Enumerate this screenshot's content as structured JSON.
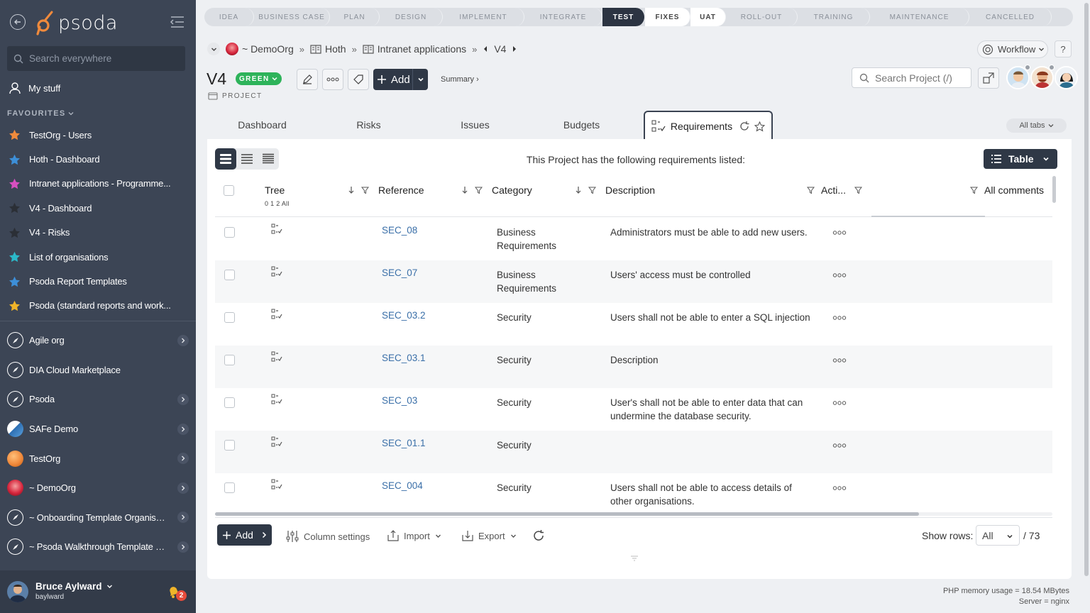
{
  "app": {
    "logo_text": "psoda"
  },
  "sidebar": {
    "search_placeholder": "Search everywhere",
    "my_stuff": "My stuff",
    "favourites_label": "FAVOURITES",
    "favourites": [
      {
        "label": "TestOrg - Users",
        "color": "#f08a3c"
      },
      {
        "label": "Hoth - Dashboard",
        "color": "#3d8fd8"
      },
      {
        "label": "Intranet applications - Programme...",
        "color": "#d84fc0"
      },
      {
        "label": "V4 - Dashboard",
        "color": "#2b2f36"
      },
      {
        "label": "V4 - Risks",
        "color": "#2b2f36"
      },
      {
        "label": "List of organisations",
        "color": "#2bb8c9"
      },
      {
        "label": "Psoda Report Templates",
        "color": "#3d8fd8"
      },
      {
        "label": "Psoda (standard reports and work...",
        "color": "#f0b429"
      }
    ],
    "orgs": [
      {
        "label": "Agile org",
        "icon": "compass",
        "has_children": true
      },
      {
        "label": "DIA Cloud Marketplace",
        "icon": "compass",
        "has_children": false
      },
      {
        "label": "Psoda",
        "icon": "compass",
        "has_children": true
      },
      {
        "label": "SAFe Demo",
        "icon": "safe",
        "has_children": true
      },
      {
        "label": "TestOrg",
        "icon": "orange",
        "has_children": true
      },
      {
        "label": "~ DemoOrg",
        "icon": "red",
        "has_children": true
      },
      {
        "label": "~ Onboarding Template Organisa...",
        "icon": "compass",
        "has_children": true
      },
      {
        "label": "~ Psoda Walkthrough Template P...",
        "icon": "compass",
        "has_children": true
      }
    ],
    "user": {
      "name": "Bruce Aylward",
      "login": "baylward",
      "notifications": "2"
    }
  },
  "stages": [
    {
      "label": "IDEA",
      "state": "done"
    },
    {
      "label": "BUSINESS CASE",
      "state": "done"
    },
    {
      "label": "PLAN",
      "state": "done"
    },
    {
      "label": "DESIGN",
      "state": "done"
    },
    {
      "label": "IMPLEMENT",
      "state": "done"
    },
    {
      "label": "INTEGRATE",
      "state": "done"
    },
    {
      "label": "TEST",
      "state": "active"
    },
    {
      "label": "FIXES",
      "state": "after"
    },
    {
      "label": "UAT",
      "state": "after"
    },
    {
      "label": "ROLL-OUT",
      "state": "later"
    },
    {
      "label": "TRAINING",
      "state": "later"
    },
    {
      "label": "MAINTENANCE",
      "state": "later"
    },
    {
      "label": "CANCELLED",
      "state": "later"
    }
  ],
  "breadcrumb": {
    "org": "~ DemoOrg",
    "programme": "Hoth",
    "sub": "Intranet applications",
    "project": "V4"
  },
  "header": {
    "workflow": "Workflow",
    "help": "?",
    "title": "V4",
    "status": "GREEN",
    "add": "Add",
    "summary": "Summary ›",
    "type": "PROJECT",
    "search_placeholder": "Search Project (/)"
  },
  "tabs": {
    "items": [
      "Dashboard",
      "Risks",
      "Issues",
      "Budgets"
    ],
    "active": "Requirements",
    "all_tabs": "All tabs"
  },
  "panel": {
    "note": "This Project has the following requirements listed:",
    "view": "Table",
    "columns": {
      "tree": "Tree",
      "tree_levels": "0 1 2 All",
      "reference": "Reference",
      "category": "Category",
      "description": "Description",
      "actions": "Acti...",
      "comments": "All comments"
    },
    "rows": [
      {
        "ref": "SEC_08",
        "category": "Business Requirements",
        "description": "Administrators must be able to add new users."
      },
      {
        "ref": "SEC_07",
        "category": "Business Requirements",
        "description": "Users' access must be controlled"
      },
      {
        "ref": "SEC_03.2",
        "category": "Security",
        "description": "Users shall not be able to enter a SQL injection"
      },
      {
        "ref": "SEC_03.1",
        "category": "Security",
        "description": "Description"
      },
      {
        "ref": "SEC_03",
        "category": "Security",
        "description": "User's shall not be able to enter data that can undermine the database security."
      },
      {
        "ref": "SEC_01.1",
        "category": "Security",
        "description": ""
      },
      {
        "ref": "SEC_004",
        "category": "Security",
        "description": "Users shall not be able to access details of other organisations."
      }
    ],
    "footer": {
      "add": "Add",
      "column_settings": "Column settings",
      "import": "Import",
      "export": "Export",
      "show_rows_label": "Show rows:",
      "show_rows_value": "All",
      "total": "/ 73"
    }
  },
  "server": {
    "memory": "PHP memory usage = 18.54 MBytes",
    "server": "Server = nginx"
  },
  "colors": {
    "sidebar_bg": "#3c4555",
    "accent_dark": "#2f3846",
    "status_green": "#2eb35a",
    "link": "#3a6fa8"
  }
}
